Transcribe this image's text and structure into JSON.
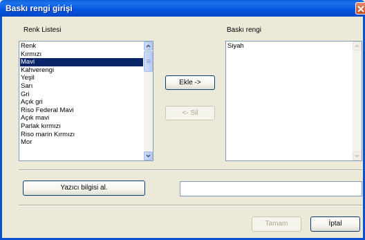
{
  "window": {
    "title": "Baskı rengi girişi"
  },
  "left_list": {
    "label": "Renk Listesi",
    "items": [
      "Renk",
      "Kırmızı",
      "Mavi",
      "Kahverengi",
      "Yeşil",
      "Sarı",
      "Gri",
      "Açık gri",
      "Riso Federal Mavi",
      "Açık mavi",
      "Parlak kırmızı",
      "Riso marin Kırmızı",
      "Mor"
    ],
    "selected": "Mavi"
  },
  "right_list": {
    "label": "Baskı rengi",
    "items": [
      "Siyah"
    ]
  },
  "buttons": {
    "add": "Ekle ->",
    "remove": "<- Sil",
    "printer_info": "Yazıcı bilgisi al.",
    "ok": "Tamam",
    "cancel": "İptal"
  },
  "printer_info_value": ""
}
